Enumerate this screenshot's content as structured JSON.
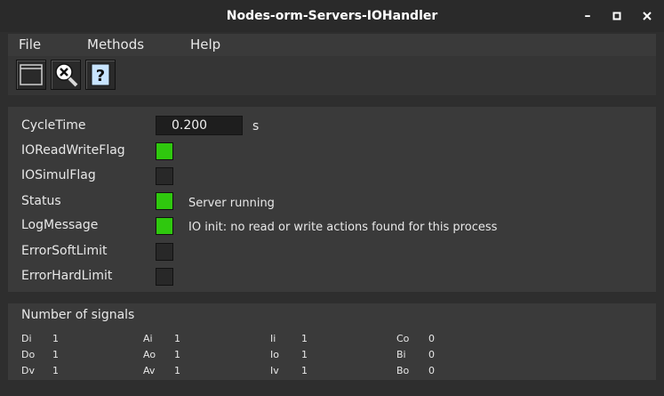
{
  "window": {
    "title": "Nodes-orm-Servers-IOHandler",
    "minimize_glyph": "–",
    "maximize_glyph": "□",
    "close_glyph": "✕"
  },
  "menu": {
    "file": "File",
    "methods": "Methods",
    "help": "Help"
  },
  "toolbar": {
    "buttons": [
      {
        "icon": "graph-window-icon"
      },
      {
        "icon": "crossref-search-icon"
      },
      {
        "icon": "help-icon",
        "glyph": "?"
      }
    ]
  },
  "attributes": {
    "cycletime": {
      "label": "CycleTime",
      "value": "0.200",
      "unit": "s"
    },
    "ioreadwrite": {
      "label": "IOReadWriteFlag",
      "state": "on"
    },
    "iosimul": {
      "label": "IOSimulFlag",
      "state": "off"
    },
    "status": {
      "label": "Status",
      "state": "on",
      "text": "Server running"
    },
    "logmessage": {
      "label": "LogMessage",
      "state": "on",
      "text": "IO init: no read or write actions found for this process"
    },
    "errsoft": {
      "label": "ErrorSoftLimit",
      "state": "off"
    },
    "errhard": {
      "label": "ErrorHardLimit",
      "state": "off"
    }
  },
  "signals": {
    "title": "Number of signals",
    "rows": [
      [
        {
          "name": "Di",
          "count": "1"
        },
        {
          "name": "Ai",
          "count": "1"
        },
        {
          "name": "Ii",
          "count": "1"
        },
        {
          "name": "Co",
          "count": "0"
        }
      ],
      [
        {
          "name": "Do",
          "count": "1"
        },
        {
          "name": "Ao",
          "count": "1"
        },
        {
          "name": "Io",
          "count": "1"
        },
        {
          "name": "Bi",
          "count": "0"
        }
      ],
      [
        {
          "name": "Dv",
          "count": "1"
        },
        {
          "name": "Av",
          "count": "1"
        },
        {
          "name": "Iv",
          "count": "1"
        },
        {
          "name": "Bo",
          "count": "0"
        }
      ]
    ]
  },
  "colors": {
    "led_on": "#2fc80e",
    "led_off": "#282828",
    "background": "#2e2e2e",
    "panel": "#3a3a3a"
  }
}
